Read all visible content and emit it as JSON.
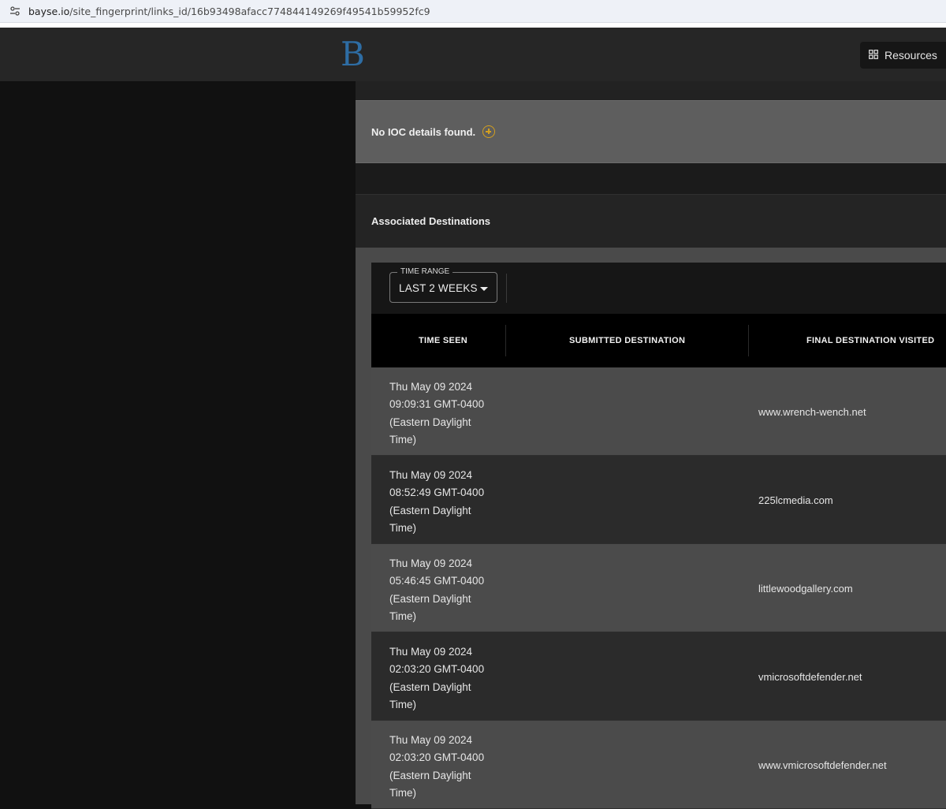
{
  "browser": {
    "url_host": "bayse.io",
    "url_path": "/site_fingerprint/links_id/16b93498afacc774844149269f49541b59952fc9",
    "site_settings_icon": "tune-icon"
  },
  "header": {
    "logo_text": "B",
    "resources_label": "Resources",
    "resources_icon": "grid-icon"
  },
  "ioc": {
    "message": "No IOC details found.",
    "add_icon": "plus-circle-icon"
  },
  "associated": {
    "title": "Associated Destinations",
    "time_range": {
      "label": "TIME RANGE",
      "value": "LAST 2 WEEKS"
    },
    "columns": {
      "time_seen": "TIME SEEN",
      "submitted": "SUBMITTED DESTINATION",
      "final": "FINAL DESTINATION VISITED"
    },
    "rows": [
      {
        "time": [
          "Thu May 09 2024",
          "09:09:31 GMT-0400",
          "(Eastern Daylight",
          "Time)"
        ],
        "submitted": "",
        "final": "www.wrench-wench.net"
      },
      {
        "time": [
          "Thu May 09 2024",
          "08:52:49 GMT-0400",
          "(Eastern Daylight",
          "Time)"
        ],
        "submitted": "",
        "final": "225lcmedia.com"
      },
      {
        "time": [
          "Thu May 09 2024",
          "05:46:45 GMT-0400",
          "(Eastern Daylight",
          "Time)"
        ],
        "submitted": "",
        "final": "littlewoodgallery.com"
      },
      {
        "time": [
          "Thu May 09 2024",
          "02:03:20 GMT-0400",
          "(Eastern Daylight",
          "Time)"
        ],
        "submitted": "",
        "final": "vmicrosoftdefender.net"
      },
      {
        "time": [
          "Thu May 09 2024",
          "02:03:20 GMT-0400",
          "(Eastern Daylight",
          "Time)"
        ],
        "submitted": "",
        "final": "www.vmicrosoftdefender.net"
      }
    ]
  }
}
